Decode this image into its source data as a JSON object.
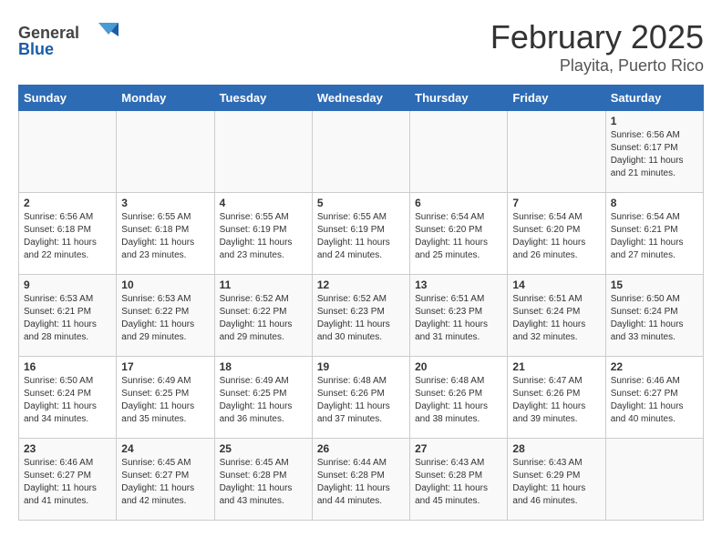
{
  "header": {
    "logo_general": "General",
    "logo_blue": "Blue",
    "title": "February 2025",
    "subtitle": "Playita, Puerto Rico"
  },
  "days_of_week": [
    "Sunday",
    "Monday",
    "Tuesday",
    "Wednesday",
    "Thursday",
    "Friday",
    "Saturday"
  ],
  "weeks": [
    [
      {
        "day": "",
        "info": ""
      },
      {
        "day": "",
        "info": ""
      },
      {
        "day": "",
        "info": ""
      },
      {
        "day": "",
        "info": ""
      },
      {
        "day": "",
        "info": ""
      },
      {
        "day": "",
        "info": ""
      },
      {
        "day": "1",
        "info": "Sunrise: 6:56 AM\nSunset: 6:17 PM\nDaylight: 11 hours\nand 21 minutes."
      }
    ],
    [
      {
        "day": "2",
        "info": "Sunrise: 6:56 AM\nSunset: 6:18 PM\nDaylight: 11 hours\nand 22 minutes."
      },
      {
        "day": "3",
        "info": "Sunrise: 6:55 AM\nSunset: 6:18 PM\nDaylight: 11 hours\nand 23 minutes."
      },
      {
        "day": "4",
        "info": "Sunrise: 6:55 AM\nSunset: 6:19 PM\nDaylight: 11 hours\nand 23 minutes."
      },
      {
        "day": "5",
        "info": "Sunrise: 6:55 AM\nSunset: 6:19 PM\nDaylight: 11 hours\nand 24 minutes."
      },
      {
        "day": "6",
        "info": "Sunrise: 6:54 AM\nSunset: 6:20 PM\nDaylight: 11 hours\nand 25 minutes."
      },
      {
        "day": "7",
        "info": "Sunrise: 6:54 AM\nSunset: 6:20 PM\nDaylight: 11 hours\nand 26 minutes."
      },
      {
        "day": "8",
        "info": "Sunrise: 6:54 AM\nSunset: 6:21 PM\nDaylight: 11 hours\nand 27 minutes."
      }
    ],
    [
      {
        "day": "9",
        "info": "Sunrise: 6:53 AM\nSunset: 6:21 PM\nDaylight: 11 hours\nand 28 minutes."
      },
      {
        "day": "10",
        "info": "Sunrise: 6:53 AM\nSunset: 6:22 PM\nDaylight: 11 hours\nand 29 minutes."
      },
      {
        "day": "11",
        "info": "Sunrise: 6:52 AM\nSunset: 6:22 PM\nDaylight: 11 hours\nand 29 minutes."
      },
      {
        "day": "12",
        "info": "Sunrise: 6:52 AM\nSunset: 6:23 PM\nDaylight: 11 hours\nand 30 minutes."
      },
      {
        "day": "13",
        "info": "Sunrise: 6:51 AM\nSunset: 6:23 PM\nDaylight: 11 hours\nand 31 minutes."
      },
      {
        "day": "14",
        "info": "Sunrise: 6:51 AM\nSunset: 6:24 PM\nDaylight: 11 hours\nand 32 minutes."
      },
      {
        "day": "15",
        "info": "Sunrise: 6:50 AM\nSunset: 6:24 PM\nDaylight: 11 hours\nand 33 minutes."
      }
    ],
    [
      {
        "day": "16",
        "info": "Sunrise: 6:50 AM\nSunset: 6:24 PM\nDaylight: 11 hours\nand 34 minutes."
      },
      {
        "day": "17",
        "info": "Sunrise: 6:49 AM\nSunset: 6:25 PM\nDaylight: 11 hours\nand 35 minutes."
      },
      {
        "day": "18",
        "info": "Sunrise: 6:49 AM\nSunset: 6:25 PM\nDaylight: 11 hours\nand 36 minutes."
      },
      {
        "day": "19",
        "info": "Sunrise: 6:48 AM\nSunset: 6:26 PM\nDaylight: 11 hours\nand 37 minutes."
      },
      {
        "day": "20",
        "info": "Sunrise: 6:48 AM\nSunset: 6:26 PM\nDaylight: 11 hours\nand 38 minutes."
      },
      {
        "day": "21",
        "info": "Sunrise: 6:47 AM\nSunset: 6:26 PM\nDaylight: 11 hours\nand 39 minutes."
      },
      {
        "day": "22",
        "info": "Sunrise: 6:46 AM\nSunset: 6:27 PM\nDaylight: 11 hours\nand 40 minutes."
      }
    ],
    [
      {
        "day": "23",
        "info": "Sunrise: 6:46 AM\nSunset: 6:27 PM\nDaylight: 11 hours\nand 41 minutes."
      },
      {
        "day": "24",
        "info": "Sunrise: 6:45 AM\nSunset: 6:27 PM\nDaylight: 11 hours\nand 42 minutes."
      },
      {
        "day": "25",
        "info": "Sunrise: 6:45 AM\nSunset: 6:28 PM\nDaylight: 11 hours\nand 43 minutes."
      },
      {
        "day": "26",
        "info": "Sunrise: 6:44 AM\nSunset: 6:28 PM\nDaylight: 11 hours\nand 44 minutes."
      },
      {
        "day": "27",
        "info": "Sunrise: 6:43 AM\nSunset: 6:28 PM\nDaylight: 11 hours\nand 45 minutes."
      },
      {
        "day": "28",
        "info": "Sunrise: 6:43 AM\nSunset: 6:29 PM\nDaylight: 11 hours\nand 46 minutes."
      },
      {
        "day": "",
        "info": ""
      }
    ]
  ]
}
